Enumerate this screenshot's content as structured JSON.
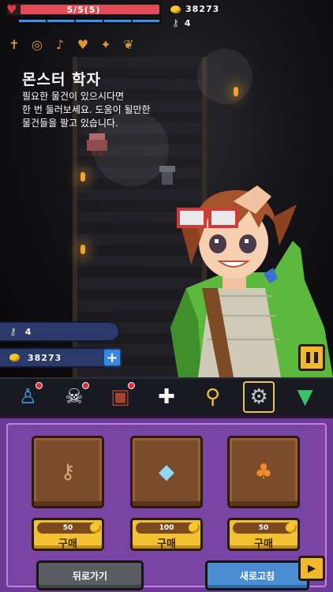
{
  "hud": {
    "hp_text": "5/5(5)",
    "hp_fraction": 1.0,
    "mp_segments": 5,
    "gold": "38273",
    "keys": "4"
  },
  "relics": [
    {
      "name": "dagger-icon",
      "glyph": "✝"
    },
    {
      "name": "ring-icon",
      "glyph": "◎"
    },
    {
      "name": "guitar-icon",
      "glyph": "♪"
    },
    {
      "name": "heart-relic-icon",
      "glyph": "♥"
    },
    {
      "name": "torch-icon",
      "glyph": "✦"
    },
    {
      "name": "leaf-icon",
      "glyph": "❦"
    }
  ],
  "npc": {
    "name": "몬스터 학자",
    "dialog": "필요한 물건이 있으시다면\n한 번 둘러보세요. 도움이 될만한\n물건들을 팔고 있습니다."
  },
  "pills": {
    "keys": "4",
    "gold": "38273"
  },
  "menu": [
    {
      "name": "character-menu-icon",
      "glyph": "♙",
      "color": "#3a9be8",
      "badge": true
    },
    {
      "name": "skull-menu-icon",
      "glyph": "☠",
      "color": "#f0f0f0",
      "badge": true
    },
    {
      "name": "backpack-menu-icon",
      "glyph": "▣",
      "color": "#a5452c",
      "badge": true
    },
    {
      "name": "heal-menu-icon",
      "glyph": "✚",
      "color": "#f4f4f4",
      "badge": false
    },
    {
      "name": "search-menu-icon",
      "glyph": "⚲",
      "color": "#f2c232",
      "badge": false
    },
    {
      "name": "settings-menu-icon",
      "glyph": "⚙",
      "color": "#c8c8c8",
      "badge": false
    },
    {
      "name": "collapse-menu-icon",
      "glyph": "▼",
      "color": "#3cc46a",
      "badge": false
    }
  ],
  "shop": {
    "items": [
      {
        "name": "key-item-icon",
        "glyph": "⚷",
        "color": "#d5a878",
        "price": "50",
        "buy_label": "구매"
      },
      {
        "name": "crystal-item-icon",
        "glyph": "◆",
        "color": "#8fd8f5",
        "price": "100",
        "buy_label": "구매"
      },
      {
        "name": "carrot-item-icon",
        "glyph": "♣",
        "color": "#f18a2a",
        "price": "50",
        "buy_label": "구매"
      }
    ],
    "back_label": "뒤로가기",
    "refresh_label": "새로고침"
  }
}
